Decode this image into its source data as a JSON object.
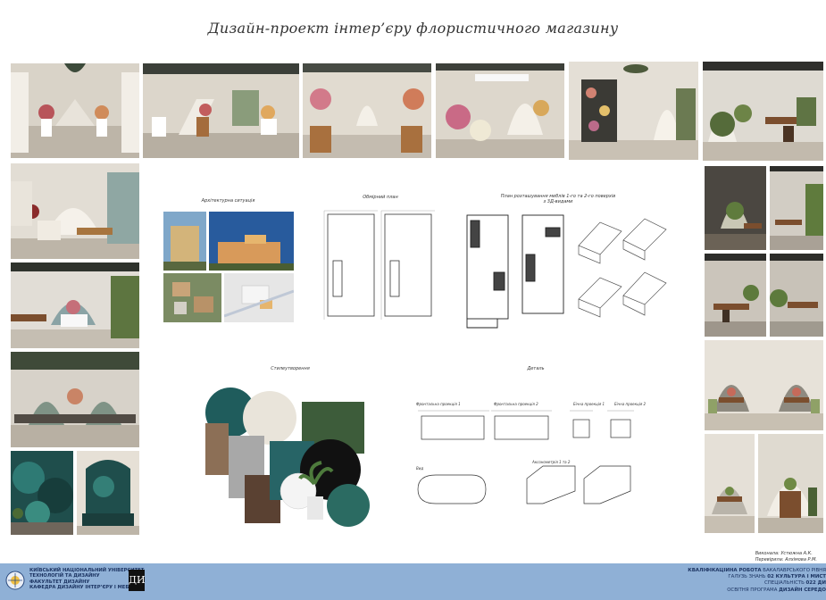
{
  "title": "Дизайн-проект інтер’єру флористичного магазину",
  "sections": {
    "architectural_situation": "Архітектурна ситуація",
    "measured_plan": "Обмірний план",
    "furniture_plan": "План розташування меблів 1-го та 2-го поверхів з 3Д-видами",
    "moodboard": "Стилеутворення",
    "details": "Деталь"
  },
  "detail_labels": {
    "d1": "Фронтальна проекція 1",
    "d2": "Фронтальна проекція 2",
    "d3": "Бічна проекція 1",
    "d4": "Бічна проекція 2",
    "d5": "Вид",
    "d6": "Аксонометрія 1 та 2"
  },
  "authors": {
    "line1": "Виконала: Устюжна А.К.",
    "line2": "Перевірила: Алхімова Р.М."
  },
  "footer": {
    "university": [
      "КИЇВСЬКИЙ НАЦІОНАЛЬНИЙ УНІВЕРСИТЕТ",
      "ТЕХНОЛОГІЙ ТА ДИЗАЙНУ",
      "ФАКУЛЬТЕТ ДИЗАЙНУ",
      "КАФЕДРА ДИЗАЙНУ ІНТЕР’ЄРУ І МЕБЛІВ"
    ],
    "dept_logo": "ДИ",
    "work_line1_bold": "КВАЛІФІКАЦІЙНА РОБОТА",
    "work_line1": "БАКАЛАВРСЬКОГО РІВНЯ",
    "work_line2": "ГАЛУЗЬ ЗНАНЬ",
    "work_line2_bold": "02 КУЛЬТУРА І МИСТ",
    "work_line3": "СПЕЦІАЛЬНІСТЬ",
    "work_line3_bold": "022 ДИ",
    "work_line4": "ОСВІТНЯ ПРОГРАМА",
    "work_line4_bold": "ДИЗАЙН СЕРЕДО"
  },
  "colors": {
    "footer_bg": "#8fb0d6",
    "footer_text": "#1d3563"
  }
}
